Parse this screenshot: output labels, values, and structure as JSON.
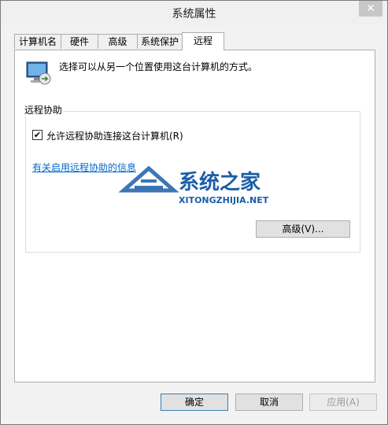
{
  "window": {
    "title": "系统属性",
    "close": "✕"
  },
  "tabs": [
    {
      "label": "计算机名"
    },
    {
      "label": "硬件"
    },
    {
      "label": "高级"
    },
    {
      "label": "系统保护"
    },
    {
      "label": "远程",
      "active": true
    }
  ],
  "remote": {
    "description": "选择可以从另一个位置使用这台计算机的方式。",
    "group_title": "远程协助",
    "checkbox_checked": true,
    "checkbox_label": "允许远程协助连接这台计算机(R)",
    "help_link": "有关启用远程协助的信息",
    "advanced_button": "高级(V)..."
  },
  "footer": {
    "ok_button": "确定",
    "cancel_button": "取消",
    "apply_button": "应用(A)"
  },
  "watermark": {
    "brand": "系统之家",
    "site": "XITONGZHIJIA.NET",
    "color": "#1b5ea8"
  },
  "icons": {
    "computer": "computer-icon",
    "check": "✔"
  }
}
